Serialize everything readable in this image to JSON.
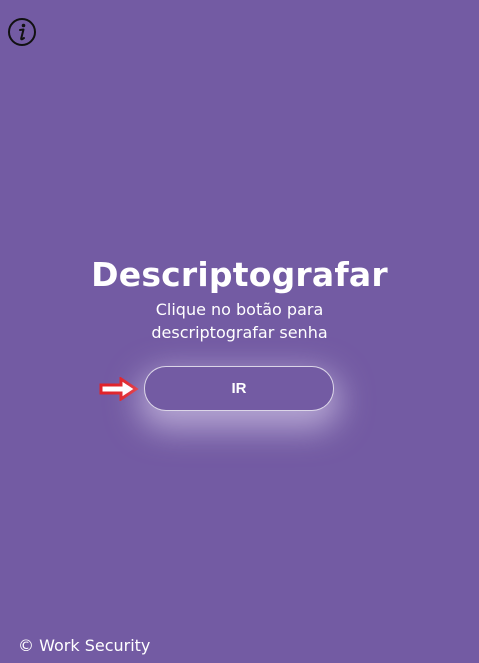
{
  "header": {
    "info_icon": "info-icon"
  },
  "main": {
    "title": "Descriptografar",
    "subtitle_line1": "Clique no botão para",
    "subtitle_line2": "descriptografar senha",
    "go_button_label": "IR",
    "arrow_icon": "arrow-right-icon",
    "colors": {
      "background": "#735ba3",
      "arrow": "#e0232a",
      "text": "#ffffff"
    }
  },
  "footer": {
    "copyright": "© Work Security"
  }
}
